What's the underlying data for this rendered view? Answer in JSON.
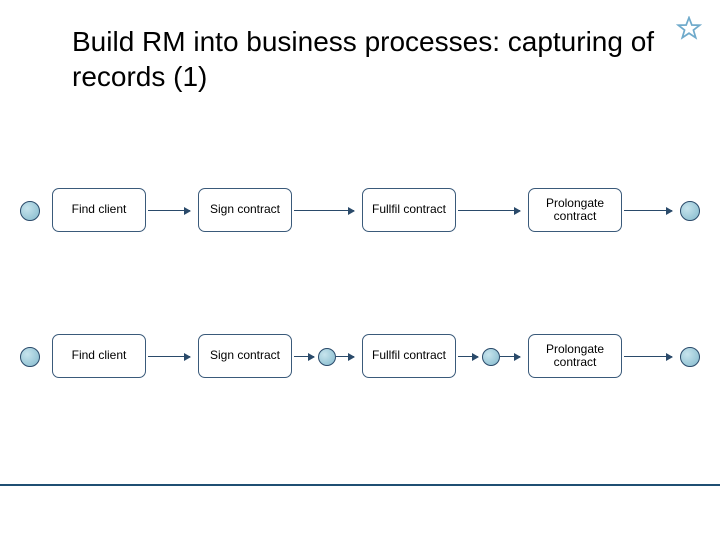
{
  "title": "Build RM into business processes: capturing of records (1)",
  "rows": [
    {
      "step1": "Find client",
      "step2": "Sign contract",
      "step3": "Fullfil contract",
      "step4": "Prolongate contract",
      "show_mid_bullets": false
    },
    {
      "step1": "Find client",
      "step2": "Sign contract",
      "step3": "Fullfil contract",
      "step4": "Prolongate contract",
      "show_mid_bullets": true
    }
  ]
}
